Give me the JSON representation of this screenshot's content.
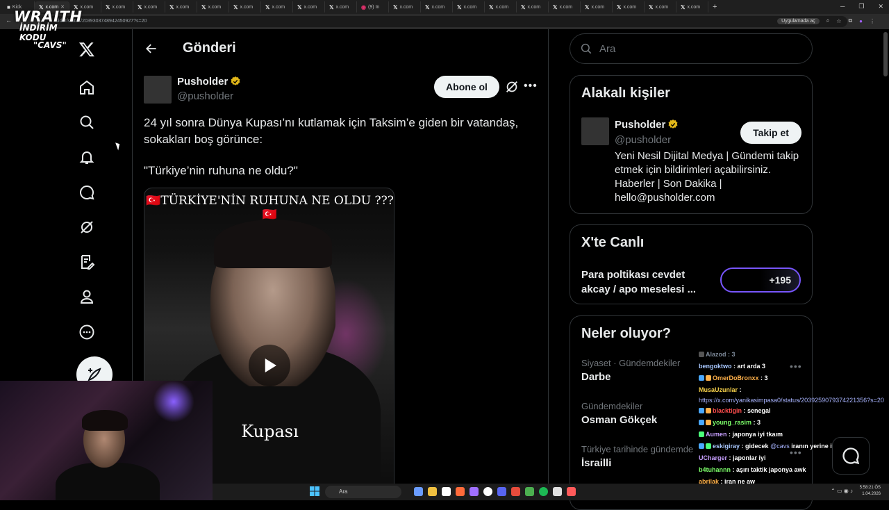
{
  "browser": {
    "tabs": [
      {
        "label": "Kick",
        "active": false
      },
      {
        "label": "x.com",
        "active": true
      },
      {
        "label": "x.com",
        "active": false
      },
      {
        "label": "x.com",
        "active": false
      },
      {
        "label": "x.com",
        "active": false
      },
      {
        "label": "x.com",
        "active": false
      },
      {
        "label": "x.com",
        "active": false
      },
      {
        "label": "x.com",
        "active": false
      },
      {
        "label": "x.com",
        "active": false
      },
      {
        "label": "x.com",
        "active": false
      },
      {
        "label": "x.com",
        "active": false
      },
      {
        "label": "(9) In",
        "active": false
      },
      {
        "label": "x.com",
        "active": false
      },
      {
        "label": "x.com",
        "active": false
      },
      {
        "label": "x.com",
        "active": false
      },
      {
        "label": "x.com",
        "active": false
      },
      {
        "label": "x.com",
        "active": false
      },
      {
        "label": "x.com",
        "active": false
      },
      {
        "label": "x.com",
        "active": false
      },
      {
        "label": "x.com",
        "active": false
      },
      {
        "label": "x.com",
        "active": false
      },
      {
        "label": "x.com",
        "active": false
      }
    ],
    "url": "older/status/2039303748942450927?s=20",
    "app_button": "Uygulamada aç",
    "new_tab": "+"
  },
  "overlay_logo": {
    "line1": "WRAITH",
    "line2": "İNDİRİM KODU",
    "line3": "\"CAVS\""
  },
  "nav": {
    "icons": [
      "x-logo-icon",
      "home-icon",
      "search-icon",
      "notifications-icon",
      "messages-icon",
      "grok-icon",
      "premium-icon",
      "profile-icon",
      "more-icon",
      "compose-icon"
    ]
  },
  "post": {
    "page_title": "Gönderi",
    "author_name": "Pusholder",
    "author_handle": "@pusholder",
    "follow_label": "Abone ol",
    "text_line": "24 yıl sonra Dünya Kupası’nı kutlamak için Taksim’e giden bir vatandaş, sokakları boş görünce:",
    "quote": "\"Türkiye’nin ruhuna ne oldu?\"",
    "video_caption_top": "🇹🇷TÜRKİYE'NİN RUHUNA NE OLDU ???🇹🇷",
    "video_caption_bottom": "Kupası"
  },
  "sidebar": {
    "search_placeholder": "Ara",
    "related_title": "Alakalı kişiler",
    "related": {
      "name": "Pusholder",
      "handle": "@pusholder",
      "follow_label": "Takip et",
      "bio": "Yeni Nesil Dijital Medya | Gündemi takip etmek için bildirimleri açabilirsiniz. Haberler | Son Dakika | hello@pusholder.com"
    },
    "live_title": "X'te Canlı",
    "live": {
      "topic": "Para poltikası cevdet akcay / apo meselesi ...",
      "count": "+195"
    },
    "trends_title": "Neler oluyor?",
    "trends": [
      {
        "meta": "Siyaset · Gündemdekiler",
        "name": "Darbe"
      },
      {
        "meta": "Gündemdekiler",
        "name": "Osman Gökçek"
      },
      {
        "meta": "Türkiye tarihinde gündemde",
        "name": "İsrailli"
      }
    ]
  },
  "chat": {
    "lines": [
      {
        "user": "Alazod",
        "msg": ": 3"
      },
      {
        "user": "bengoktwo",
        "msg": ": art arda 3"
      },
      {
        "user": "OmerDoBronxx",
        "msg": ": 3"
      },
      {
        "user": "MusaUzunlar",
        "msg": ":"
      },
      {
        "user": "",
        "msg": "https://x.com/yanikasimpasa0/status/2039259079374221356?s=20"
      },
      {
        "user": "blacktigin",
        "msg": ": senegal"
      },
      {
        "user": "young_rasim",
        "msg": ": 3"
      },
      {
        "user": "Aumen",
        "msg": ": japonya iyi tkaım"
      },
      {
        "user": "eskigiray",
        "msg": ": gidecek"
      },
      {
        "user": "",
        "msg": "@cavs"
      },
      {
        "user": "",
        "msg": "iranın yerine italya olcak"
      },
      {
        "user": "UCharger",
        "msg": ": japonlar iyi"
      },
      {
        "user": "b4tuhannn",
        "msg": ": aşırı taktik japonya awk"
      },
      {
        "user": "abrilak",
        "msg": ": iran ne aw"
      }
    ]
  },
  "taskbar": {
    "search_label": "Ara",
    "time": "5:58:21 ÖS",
    "date": "1.04.2026"
  },
  "colors": {
    "background": "#000000",
    "text": "#e7e9ea",
    "muted": "#71767b",
    "border": "#2f3336",
    "button_bg": "#eff3f4",
    "verified": "#e2b719",
    "live_accent": "#7856ff"
  }
}
